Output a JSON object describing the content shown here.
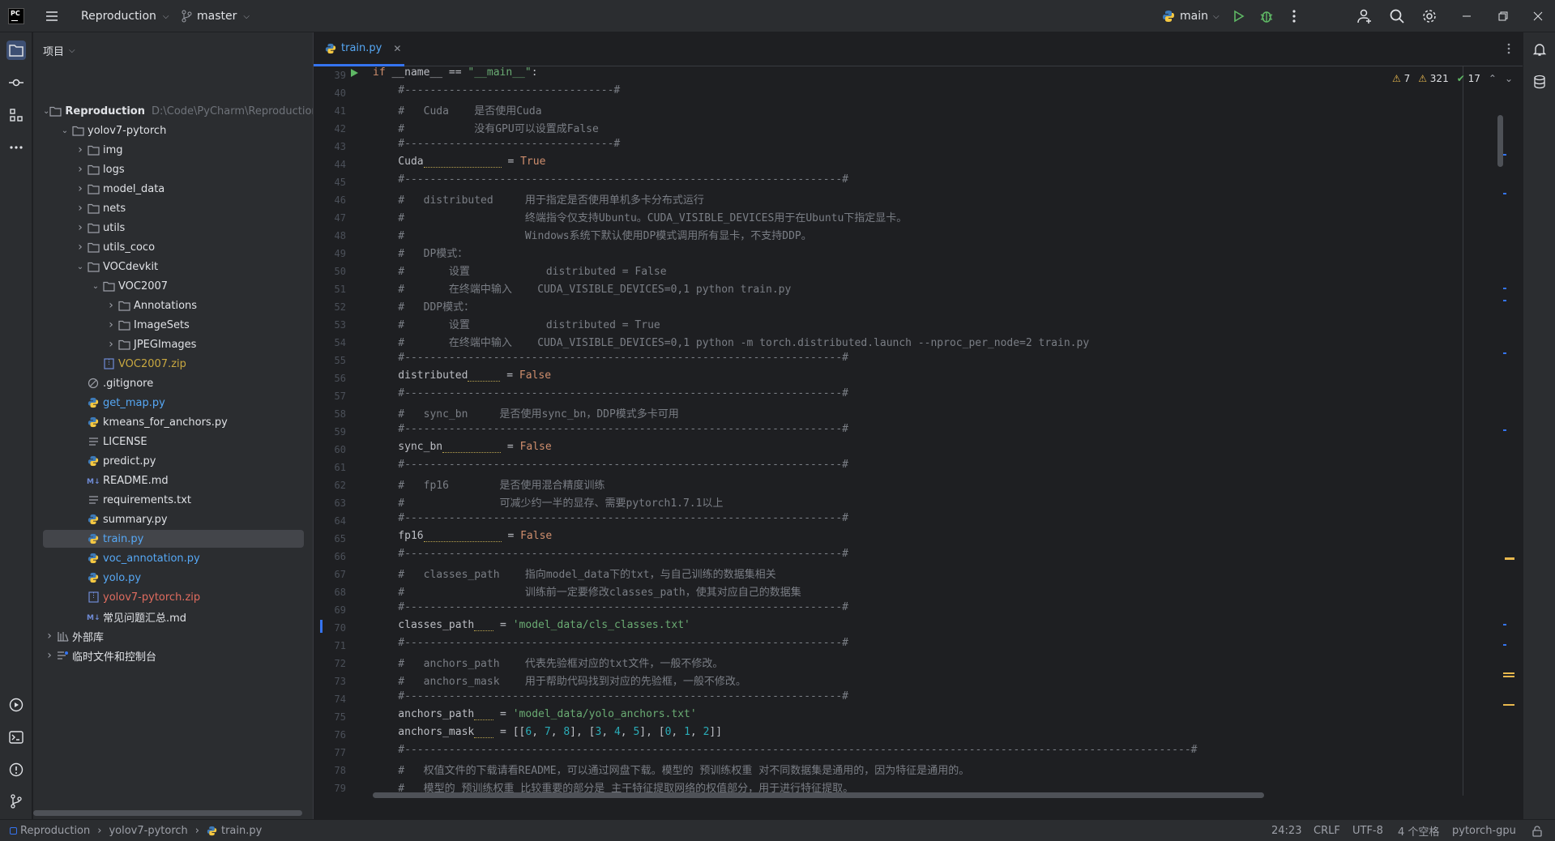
{
  "titlebar": {
    "logo_text": "PC",
    "project_name": "Reproduction",
    "branch": "master",
    "run_config": "main"
  },
  "project_panel": {
    "header": "项目",
    "tree": [
      {
        "label": "Reproduction",
        "path": "D:\\Code\\PyCharm\\Reproduction"
      },
      {
        "label": "yolov7-pytorch"
      },
      {
        "label": "img"
      },
      {
        "label": "logs"
      },
      {
        "label": "model_data"
      },
      {
        "label": "nets"
      },
      {
        "label": "utils"
      },
      {
        "label": "utils_coco"
      },
      {
        "label": "VOCdevkit"
      },
      {
        "label": "VOC2007"
      },
      {
        "label": "Annotations"
      },
      {
        "label": "ImageSets"
      },
      {
        "label": "JPEGImages"
      },
      {
        "label": "VOC2007.zip"
      },
      {
        "label": ".gitignore"
      },
      {
        "label": "get_map.py"
      },
      {
        "label": "kmeans_for_anchors.py"
      },
      {
        "label": "LICENSE"
      },
      {
        "label": "predict.py"
      },
      {
        "label": "README.md"
      },
      {
        "label": "requirements.txt"
      },
      {
        "label": "summary.py"
      },
      {
        "label": "train.py"
      },
      {
        "label": "voc_annotation.py"
      },
      {
        "label": "yolo.py"
      },
      {
        "label": "yolov7-pytorch.zip"
      },
      {
        "label": "常见问题汇总.md"
      },
      {
        "label": "外部库"
      },
      {
        "label": "临时文件和控制台"
      }
    ]
  },
  "editor": {
    "tab_label": "train.py",
    "inspections": {
      "warnings": "7",
      "weak_warnings": "321",
      "ok": "17"
    },
    "lines": {
      "n39": "39",
      "n40": "40",
      "n41": "41",
      "n42": "42",
      "n43": "43",
      "n44": "44",
      "n45": "45",
      "n46": "46",
      "n47": "47",
      "n48": "48",
      "n49": "49",
      "n50": "50",
      "n51": "51",
      "n52": "52",
      "n53": "53",
      "n54": "54",
      "n55": "55",
      "n56": "56",
      "n57": "57",
      "n58": "58",
      "n59": "59",
      "n60": "60",
      "n61": "61",
      "n62": "62",
      "n63": "63",
      "n64": "64",
      "n65": "65",
      "n66": "66",
      "n67": "67",
      "n68": "68",
      "n69": "69",
      "n70": "70",
      "n71": "71",
      "n72": "72",
      "n73": "73",
      "n74": "74",
      "n75": "75",
      "n76": "76",
      "n77": "77",
      "n78": "78",
      "n79": "79"
    },
    "code": {
      "l39_kw": "if",
      "l39_mid": " __name__ == ",
      "l39_str": "\"__main__\"",
      "l39_end": ":",
      "l40": "    #---------------------------------#",
      "l41": "    #   Cuda    是否使用Cuda",
      "l42": "    #           没有GPU可以设置成False",
      "l43": "    #---------------------------------#",
      "l44_var": "    Cuda",
      "l44_eq": " = ",
      "l44_val": "True",
      "l45": "    #---------------------------------------------------------------------#",
      "l46": "    #   distributed     用于指定是否使用单机多卡分布式运行",
      "l47": "    #                   终端指令仅支持Ubuntu。CUDA_VISIBLE_DEVICES用于在Ubuntu下指定显卡。",
      "l48": "    #                   Windows系统下默认使用DP模式调用所有显卡，不支持DDP。",
      "l49": "    #   DP模式：",
      "l50": "    #       设置            distributed = False",
      "l51": "    #       在终端中输入    CUDA_VISIBLE_DEVICES=0,1 python train.py",
      "l52": "    #   DDP模式：",
      "l53": "    #       设置            distributed = True",
      "l54": "    #       在终端中输入    CUDA_VISIBLE_DEVICES=0,1 python -m torch.distributed.launch --nproc_per_node=2 train.py",
      "l55": "    #---------------------------------------------------------------------#",
      "l56_var": "    distributed",
      "l56_eq": " = ",
      "l56_val": "False",
      "l57": "    #---------------------------------------------------------------------#",
      "l58": "    #   sync_bn     是否使用sync_bn，DDP模式多卡可用",
      "l59": "    #---------------------------------------------------------------------#",
      "l60_var": "    sync_bn",
      "l60_eq": " = ",
      "l60_val": "False",
      "l61": "    #---------------------------------------------------------------------#",
      "l62": "    #   fp16        是否使用混合精度训练",
      "l63": "    #               可减少约一半的显存、需要pytorch1.7.1以上",
      "l64": "    #---------------------------------------------------------------------#",
      "l65_var": "    fp16",
      "l65_eq": " = ",
      "l65_val": "False",
      "l66": "    #---------------------------------------------------------------------#",
      "l67": "    #   classes_path    指向model_data下的txt，与自己训练的数据集相关",
      "l68": "    #                   训练前一定要修改classes_path，使其对应自己的数据集",
      "l69": "    #---------------------------------------------------------------------#",
      "l70_var": "    classes_path",
      "l70_eq": " = ",
      "l70_val": "'model_data/cls_classes.txt'",
      "l71": "    #---------------------------------------------------------------------#",
      "l72": "    #   anchors_path    代表先验框对应的txt文件，一般不修改。",
      "l73": "    #   anchors_mask    用于帮助代码找到对应的先验框，一般不修改。",
      "l74": "    #---------------------------------------------------------------------#",
      "l75_var": "    anchors_path",
      "l75_eq": " = ",
      "l75_val": "'model_data/yolo_anchors.txt'",
      "l76_var": "    anchors_mask",
      "l76_eq": " = [[",
      "l76_a": "6",
      "l76_b": "7",
      "l76_c": "8",
      "l76_d": "3",
      "l76_e": "4",
      "l76_f": "5",
      "l76_g": "0",
      "l76_h": "1",
      "l76_i": "2",
      "l77": "    #----------------------------------------------------------------------------------------------------------------------------#",
      "l78": "    #   权值文件的下载请看README，可以通过网盘下载。模型的 预训练权重 对不同数据集是通用的，因为特征是通用的。",
      "l79": "    #   模型的 预训练权重 比较重要的部分是 主干特征提取网络的权值部分，用于进行特征提取。"
    }
  },
  "statusbar": {
    "crumb1": "Reproduction",
    "crumb2": "yolov7-pytorch",
    "crumb3": "train.py",
    "position": "24:23",
    "line_sep": "CRLF",
    "encoding": "UTF-8",
    "indent": "4 个空格",
    "interpreter": "pytorch-gpu"
  },
  "colors": {
    "accent": "#3574f0",
    "keyword": "#cf8e6d",
    "string": "#6aab73",
    "number": "#2aacb8",
    "comment": "#7a7e85"
  }
}
